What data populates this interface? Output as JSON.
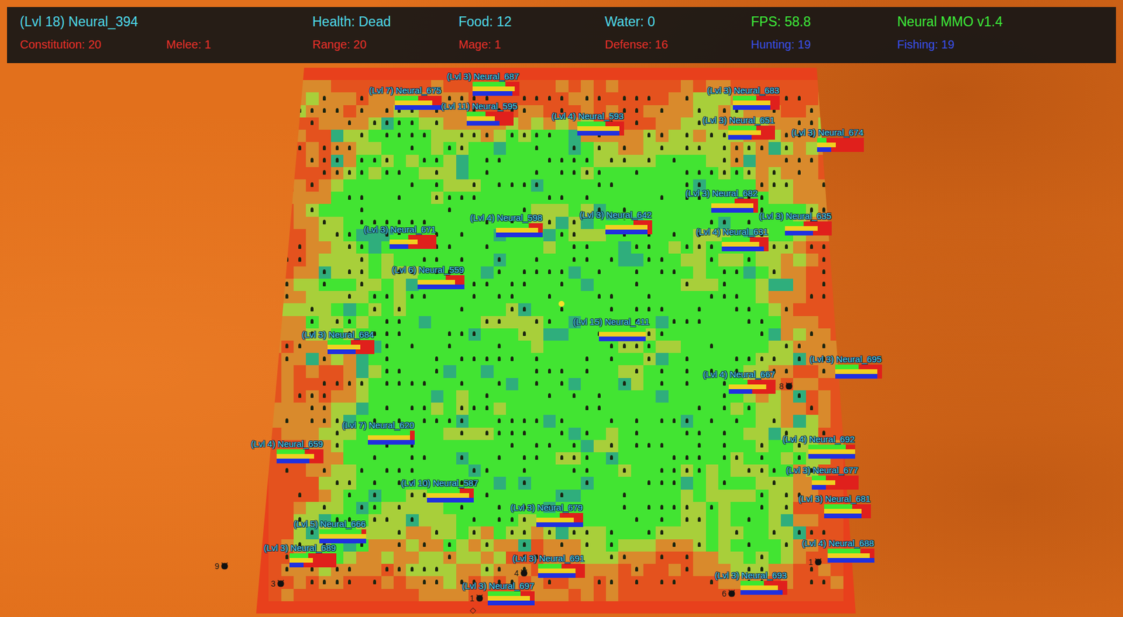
{
  "hud": {
    "player": {
      "text": "(Lvl 18) Neural_394",
      "color": "#4fd8e8"
    },
    "top": [
      {
        "text": "Health: Dead",
        "color": "#4fd8e8"
      },
      {
        "text": "Food: 12",
        "color": "#4fd8e8"
      },
      {
        "text": "Water: 0",
        "color": "#4fd8e8"
      },
      {
        "text": "FPS: 58.8",
        "color": "#3de83a"
      },
      {
        "text": "Neural MMO v1.4",
        "color": "#3de83a"
      }
    ],
    "skills": [
      {
        "text": "Constitution: 20",
        "color": "#e8302a"
      },
      {
        "text": "Melee: 1",
        "color": "#e8302a"
      },
      {
        "text": "Range: 20",
        "color": "#e8302a"
      },
      {
        "text": "Mage: 1",
        "color": "#e8302a"
      },
      {
        "text": "Defense: 16",
        "color": "#e8302a"
      },
      {
        "text": "Hunting: 19",
        "color": "#3a50e8"
      },
      {
        "text": "Fishing: 19",
        "color": "#3a50e8"
      }
    ]
  },
  "agents": [
    {
      "label": "(Lvl 3) Neural_687",
      "health": 0.7,
      "food": 0.9,
      "water": 0.85
    },
    {
      "label": "(Lvl 7) Neural_675",
      "health": 0.5,
      "food": 0.8,
      "water": 1.0
    },
    {
      "label": "(Lvl 11) Neural_595",
      "health": 0.4,
      "food": 0.6,
      "water": 0.7
    },
    {
      "label": "(Lvl 4) Neural_593",
      "health": 0.6,
      "food": 0.9,
      "water": 0.9
    },
    {
      "label": "(Lvl 3) Neural_683",
      "health": 0.5,
      "food": 0.8,
      "water": 0.8
    },
    {
      "label": "(Lvl 3) Neural_651",
      "health": 0.6,
      "food": 0.7,
      "water": 0.5
    },
    {
      "label": "(Lvl 3) Neural_674",
      "health": 0.2,
      "food": 0.4,
      "water": 0.3
    },
    {
      "label": "(Lvl 3) Neural_682",
      "health": 0.5,
      "food": 0.9,
      "water": 0.9
    },
    {
      "label": "(Lvl 3) Neural_635",
      "health": 0.4,
      "food": 0.7,
      "water": 0.6
    },
    {
      "label": "(Lvl 4) Neural_631",
      "health": 0.6,
      "food": 0.8,
      "water": 0.9
    },
    {
      "label": "(Lvl 4) Neural_598",
      "health": 0.7,
      "food": 0.9,
      "water": 1.0
    },
    {
      "label": "(Lvl 3) Neural_642",
      "health": 0.6,
      "food": 0.9,
      "water": 0.9
    },
    {
      "label": "(Lvl 3) Neural_671",
      "health": 0.4,
      "food": 0.6,
      "water": 0.4
    },
    {
      "label": "(Lvl 6) Neural_559",
      "health": 0.6,
      "food": 0.8,
      "water": 1.0
    },
    {
      "label": "(Lvl 15) Neural_411",
      "health": 1.0,
      "food": 1.0,
      "water": 1.0
    },
    {
      "label": "(Lvl 3) Neural_684",
      "health": 0.5,
      "food": 0.7,
      "water": 0.6
    },
    {
      "label": "(Lvl 4) Neural_667",
      "health": 0.4,
      "food": 0.8,
      "water": 0.5
    },
    {
      "label": "(Lvl 3) Neural_695",
      "health": 0.5,
      "food": 0.9,
      "water": 0.9
    },
    {
      "label": "(Lvl 7) Neural_620",
      "health": 0.9,
      "food": 0.9,
      "water": 1.0
    },
    {
      "label": "(Lvl 4) Neural_659",
      "health": 0.6,
      "food": 0.8,
      "water": 0.7
    },
    {
      "label": "(Lvl 4) Neural_692",
      "health": 0.8,
      "food": 1.0,
      "water": 1.0
    },
    {
      "label": "(Lvl 3) Neural_677",
      "health": 0.3,
      "food": 0.5,
      "water": 0.3
    },
    {
      "label": "(Lvl 10) Neural_587",
      "health": 0.7,
      "food": 0.9,
      "water": 1.0
    },
    {
      "label": "(Lvl 3) Neural_679",
      "health": 0.5,
      "food": 0.8,
      "water": 1.0
    },
    {
      "label": "(Lvl 3) Neural_681",
      "health": 0.6,
      "food": 0.8,
      "water": 0.8
    },
    {
      "label": "(Lvl 5) Neural_666",
      "health": 0.9,
      "food": 1.0,
      "water": 1.0
    },
    {
      "label": "(Lvl 4) Neural_688",
      "health": 0.7,
      "food": 0.9,
      "water": 1.0
    },
    {
      "label": "(Lvl 3) Neural_689",
      "health": 0.4,
      "food": 0.5,
      "water": 0.3
    },
    {
      "label": "(Lvl 3) Neural_691",
      "health": 0.5,
      "food": 0.8,
      "water": 0.8
    },
    {
      "label": "(Lvl 3) Neural_697",
      "health": 0.7,
      "food": 0.9,
      "water": 1.0
    },
    {
      "label": "(Lvl 3) Neural_693",
      "health": 0.5,
      "food": 0.8,
      "water": 0.9
    }
  ],
  "markers": [
    {
      "text": "8"
    },
    {
      "text": "9"
    },
    {
      "text": "3"
    },
    {
      "text": "1"
    },
    {
      "text": "4"
    },
    {
      "text": "6"
    },
    {
      "text": "1"
    },
    {
      "text": "◇"
    }
  ]
}
